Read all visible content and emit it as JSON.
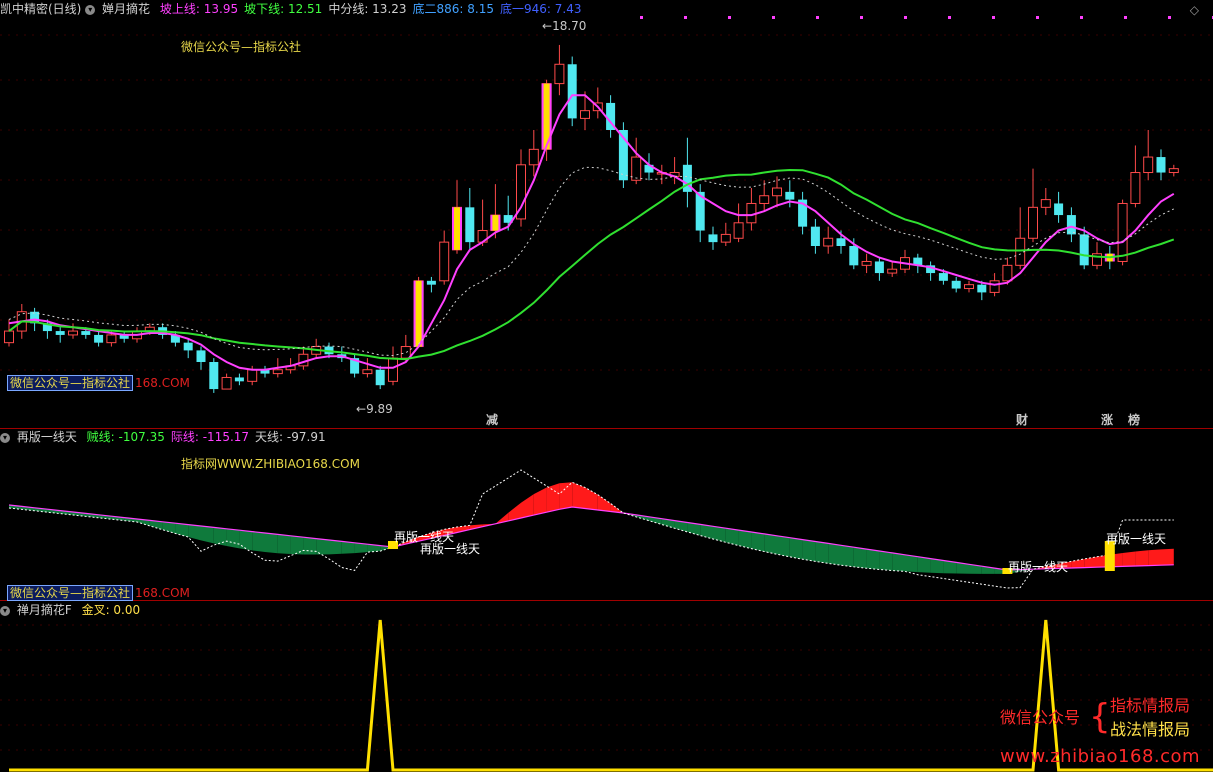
{
  "panel1": {
    "title": "凯中精密(日线)",
    "indicator": "婵月摘花",
    "values": [
      {
        "label": "坡上线:",
        "value": "13.95",
        "color": "#ff40ff"
      },
      {
        "label": "坡下线:",
        "value": "12.51",
        "color": "#40ff40"
      },
      {
        "label": "中分线:",
        "value": "13.23",
        "color": "#d0d0d0"
      },
      {
        "label": "底二886:",
        "value": "8.15",
        "color": "#40a0ff"
      },
      {
        "label": "底一946:",
        "value": "7.43",
        "color": "#4060ff"
      }
    ],
    "watermark_top": "微信公众号—指标公社",
    "watermark_box": "微信公众号—指标公社",
    "watermark_red": "168.COM",
    "high_label": "18.70",
    "low_label": "9.89",
    "signals": [
      {
        "text": "减",
        "color": "#40ff40"
      },
      {
        "text": "财",
        "color": "#40a0ff"
      },
      {
        "text": "涨",
        "color": "#ff4040"
      },
      {
        "text": "榜",
        "color": "#ffd000"
      }
    ]
  },
  "panel2": {
    "indicator": "再版一线天",
    "values": [
      {
        "label": "贼线:",
        "value": "-107.35",
        "color": "#40ff40"
      },
      {
        "label": "际线:",
        "value": "-115.17",
        "color": "#ff40ff"
      },
      {
        "label": "天线:",
        "value": "-97.91",
        "color": "#d0d0d0"
      }
    ],
    "watermark_top": "指标网WWW.ZHIBIAO168.COM",
    "watermark_box": "微信公众号—指标公社",
    "watermark_red": "168.COM",
    "signal_text": "再版一线天"
  },
  "panel3": {
    "indicator": "禅月摘花F",
    "values": [
      {
        "label": "金叉:",
        "value": "0.00",
        "color": "#ffe04a"
      }
    ]
  },
  "brand": {
    "line1": "微信公众号",
    "line2a": "指标情报局",
    "line2b": "战法情报局",
    "url": "www.zhibiao168.com"
  },
  "chart_data": [
    {
      "type": "candlestick",
      "ylim": [
        9.0,
        19.5
      ],
      "ma_upper_name": "坡上线",
      "ma_lower_name": "坡下线",
      "ma_mid_name": "中分线",
      "candles": [
        [
          11.0,
          11.3,
          11.6,
          10.9
        ],
        [
          11.3,
          11.8,
          12.0,
          11.1
        ],
        [
          11.8,
          11.5,
          11.9,
          11.3
        ],
        [
          11.5,
          11.3,
          11.6,
          11.1
        ],
        [
          11.3,
          11.2,
          11.4,
          11.0
        ],
        [
          11.2,
          11.3,
          11.5,
          11.1
        ],
        [
          11.3,
          11.2,
          11.4,
          11.1
        ],
        [
          11.2,
          11.0,
          11.3,
          10.9
        ],
        [
          11.0,
          11.2,
          11.3,
          10.9
        ],
        [
          11.2,
          11.1,
          11.3,
          11.0
        ],
        [
          11.1,
          11.3,
          11.4,
          11.0
        ],
        [
          11.3,
          11.4,
          11.5,
          11.2
        ],
        [
          11.4,
          11.2,
          11.5,
          11.1
        ],
        [
          11.2,
          11.0,
          11.3,
          10.9
        ],
        [
          11.0,
          10.8,
          11.1,
          10.6
        ],
        [
          10.8,
          10.5,
          10.9,
          10.3
        ],
        [
          10.5,
          9.8,
          10.6,
          9.7
        ],
        [
          9.8,
          10.1,
          10.2,
          9.8
        ],
        [
          10.1,
          10.0,
          10.2,
          9.9
        ],
        [
          10.0,
          10.3,
          10.4,
          9.9
        ],
        [
          10.3,
          10.2,
          10.4,
          10.1
        ],
        [
          10.2,
          10.3,
          10.6,
          10.1
        ],
        [
          10.3,
          10.4,
          10.6,
          10.2
        ],
        [
          10.4,
          10.7,
          10.9,
          10.3
        ],
        [
          10.7,
          10.9,
          11.1,
          10.6
        ],
        [
          10.9,
          10.7,
          11.0,
          10.6
        ],
        [
          10.7,
          10.6,
          10.9,
          10.5
        ],
        [
          10.6,
          10.2,
          10.7,
          10.1
        ],
        [
          10.2,
          10.3,
          10.6,
          10.1
        ],
        [
          10.3,
          9.9,
          10.4,
          9.8
        ],
        [
          10.0,
          10.6,
          10.9,
          9.9
        ],
        [
          10.6,
          10.9,
          11.2,
          10.5
        ],
        [
          10.9,
          12.6,
          12.7,
          10.9
        ],
        [
          12.6,
          12.5,
          12.7,
          12.3
        ],
        [
          12.6,
          13.6,
          13.9,
          12.5
        ],
        [
          13.4,
          14.5,
          15.2,
          13.3
        ],
        [
          14.5,
          13.6,
          15.0,
          13.4
        ],
        [
          13.6,
          13.9,
          14.7,
          13.5
        ],
        [
          13.9,
          14.3,
          15.1,
          13.7
        ],
        [
          14.3,
          14.1,
          14.8,
          13.9
        ],
        [
          14.2,
          15.6,
          16.0,
          14.0
        ],
        [
          15.6,
          16.0,
          16.5,
          15.3
        ],
        [
          16.0,
          17.7,
          17.8,
          15.7
        ],
        [
          17.7,
          18.2,
          18.7,
          17.4
        ],
        [
          18.2,
          16.8,
          18.4,
          16.6
        ],
        [
          16.8,
          17.0,
          17.5,
          16.5
        ],
        [
          17.0,
          17.2,
          17.6,
          16.8
        ],
        [
          17.2,
          16.5,
          17.4,
          16.3
        ],
        [
          16.5,
          15.2,
          16.7,
          15.0
        ],
        [
          15.2,
          15.8,
          16.3,
          15.1
        ],
        [
          15.6,
          15.4,
          15.9,
          15.2
        ],
        [
          15.4,
          15.4,
          15.6,
          15.1
        ],
        [
          15.3,
          15.4,
          15.8,
          15.1
        ],
        [
          15.6,
          14.9,
          16.3,
          14.5
        ],
        [
          14.9,
          13.9,
          15.1,
          13.6
        ],
        [
          13.8,
          13.6,
          14.0,
          13.4
        ],
        [
          13.6,
          13.8,
          14.1,
          13.5
        ],
        [
          13.7,
          14.1,
          14.6,
          13.6
        ],
        [
          14.1,
          14.6,
          15.0,
          13.9
        ],
        [
          14.6,
          14.8,
          15.2,
          14.4
        ],
        [
          14.8,
          15.0,
          15.3,
          14.5
        ],
        [
          14.9,
          14.7,
          15.2,
          14.5
        ],
        [
          14.7,
          14.0,
          14.9,
          13.8
        ],
        [
          14.0,
          13.5,
          14.2,
          13.3
        ],
        [
          13.5,
          13.7,
          14.0,
          13.3
        ],
        [
          13.7,
          13.5,
          13.9,
          13.3
        ],
        [
          13.5,
          13.0,
          13.7,
          12.9
        ],
        [
          13.0,
          13.1,
          13.3,
          12.8
        ],
        [
          13.1,
          12.8,
          13.2,
          12.6
        ],
        [
          12.8,
          12.9,
          13.1,
          12.7
        ],
        [
          12.9,
          13.2,
          13.4,
          12.8
        ],
        [
          13.2,
          13.0,
          13.3,
          12.8
        ],
        [
          13.0,
          12.8,
          13.1,
          12.6
        ],
        [
          12.8,
          12.6,
          12.9,
          12.5
        ],
        [
          12.6,
          12.4,
          12.7,
          12.3
        ],
        [
          12.4,
          12.5,
          12.6,
          12.3
        ],
        [
          12.5,
          12.3,
          12.6,
          12.1
        ],
        [
          12.3,
          12.6,
          12.8,
          12.2
        ],
        [
          12.6,
          13.0,
          13.2,
          12.5
        ],
        [
          13.0,
          13.7,
          14.5,
          12.9
        ],
        [
          13.7,
          14.5,
          15.5,
          13.6
        ],
        [
          14.5,
          14.7,
          15.0,
          14.3
        ],
        [
          14.6,
          14.3,
          14.9,
          14.1
        ],
        [
          14.3,
          13.8,
          14.5,
          13.6
        ],
        [
          13.8,
          13.0,
          14.0,
          12.9
        ],
        [
          13.0,
          13.3,
          13.6,
          12.9
        ],
        [
          13.3,
          13.1,
          13.5,
          12.9
        ],
        [
          13.1,
          14.6,
          14.7,
          13.0
        ],
        [
          14.6,
          15.4,
          16.1,
          14.5
        ],
        [
          15.4,
          15.8,
          16.5,
          15.2
        ],
        [
          15.8,
          15.4,
          16.0,
          15.2
        ],
        [
          15.4,
          15.5,
          15.6,
          15.3
        ]
      ],
      "ma_upper": [
        11.5,
        11.55,
        11.6,
        11.55,
        11.45,
        11.4,
        11.35,
        11.3,
        11.25,
        11.2,
        11.2,
        11.25,
        11.25,
        11.2,
        11.1,
        10.95,
        10.7,
        10.5,
        10.35,
        10.3,
        10.3,
        10.35,
        10.4,
        10.5,
        10.6,
        10.65,
        10.65,
        10.55,
        10.45,
        10.35,
        10.35,
        10.5,
        10.9,
        11.5,
        12.1,
        12.9,
        13.4,
        13.6,
        13.85,
        14.0,
        14.5,
        15.2,
        16.1,
        16.9,
        17.4,
        17.4,
        17.1,
        16.7,
        16.3,
        15.9,
        15.6,
        15.4,
        15.3,
        15.1,
        14.8,
        14.6,
        14.4,
        14.3,
        14.3,
        14.4,
        14.55,
        14.65,
        14.6,
        14.4,
        14.1,
        13.8,
        13.55,
        13.35,
        13.2,
        13.1,
        13.05,
        13.0,
        12.95,
        12.85,
        12.75,
        12.65,
        12.55,
        12.5,
        12.55,
        12.8,
        13.2,
        13.6,
        13.9,
        14.0,
        13.9,
        13.7,
        13.55,
        13.6,
        13.9,
        14.3,
        14.65,
        14.85
      ]
    },
    {
      "type": "area",
      "ylim": [
        -250,
        80
      ],
      "series_names": [
        "贼线",
        "际线",
        "天线"
      ]
    },
    {
      "type": "line",
      "series_name": "金叉",
      "ylim": [
        0,
        1
      ],
      "spikes_at": [
        29,
        81
      ],
      "current": 0.0
    }
  ]
}
